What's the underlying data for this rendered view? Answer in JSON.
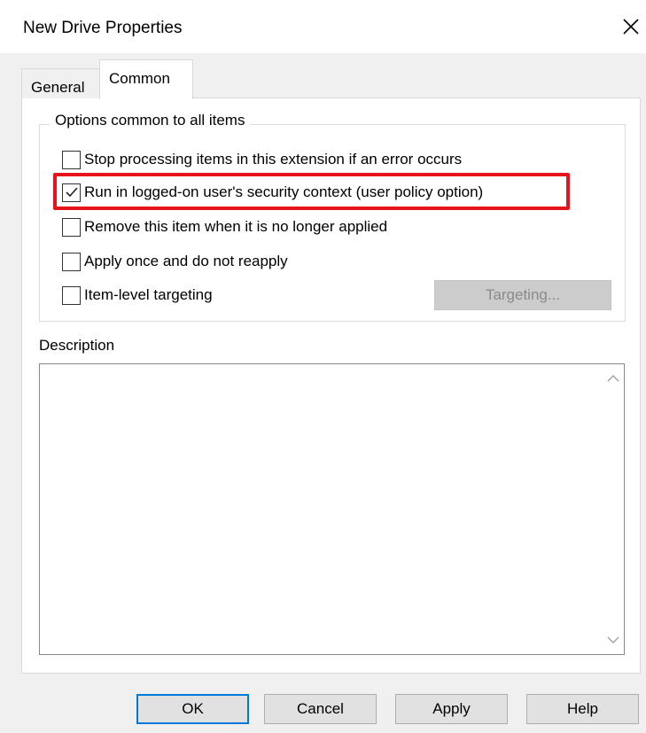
{
  "window": {
    "title": "New Drive Properties",
    "close_icon": "close-icon"
  },
  "tabs": [
    {
      "label": "General",
      "selected": false
    },
    {
      "label": "Common",
      "selected": true
    }
  ],
  "options_group": {
    "label": "Options common to all items",
    "items": [
      {
        "label": "Stop processing items in this extension if an error occurs",
        "checked": false
      },
      {
        "label": "Run in logged-on user's security context (user policy option)",
        "checked": true,
        "highlighted": true
      },
      {
        "label": "Remove this item when it is no longer applied",
        "checked": false
      },
      {
        "label": "Apply once and do not reapply",
        "checked": false
      },
      {
        "label": "Item-level targeting",
        "checked": false
      }
    ],
    "targeting_button": {
      "label": "Targeting...",
      "disabled": true
    }
  },
  "description": {
    "label": "Description",
    "value": ""
  },
  "buttons": {
    "ok": "OK",
    "cancel": "Cancel",
    "apply": "Apply",
    "help": "Help"
  },
  "colors": {
    "highlight": "#e8141c",
    "default_button_border": "#0078d7",
    "dialog_background": "#f0f0f0"
  }
}
